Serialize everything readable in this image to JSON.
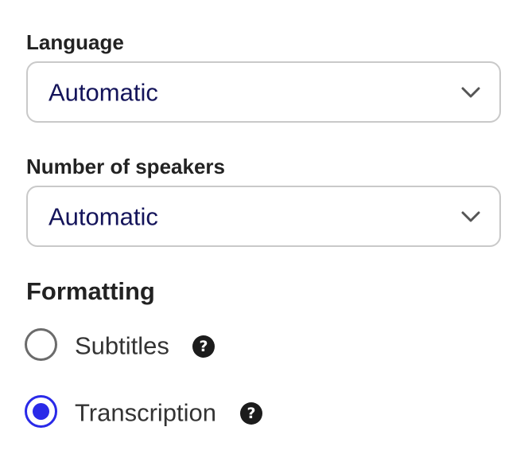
{
  "language": {
    "label": "Language",
    "value": "Automatic"
  },
  "speakers": {
    "label": "Number of speakers",
    "value": "Automatic"
  },
  "formatting": {
    "title": "Formatting",
    "options": [
      {
        "label": "Subtitles",
        "selected": false,
        "help_glyph": "?"
      },
      {
        "label": "Transcription",
        "selected": true,
        "help_glyph": "?"
      }
    ]
  },
  "colors": {
    "accent": "#2a2ae8",
    "select_text": "#14145a",
    "border": "#c9c9c9"
  },
  "icons": {
    "select_chevron": "chevron-down-icon",
    "help": "help-icon"
  }
}
